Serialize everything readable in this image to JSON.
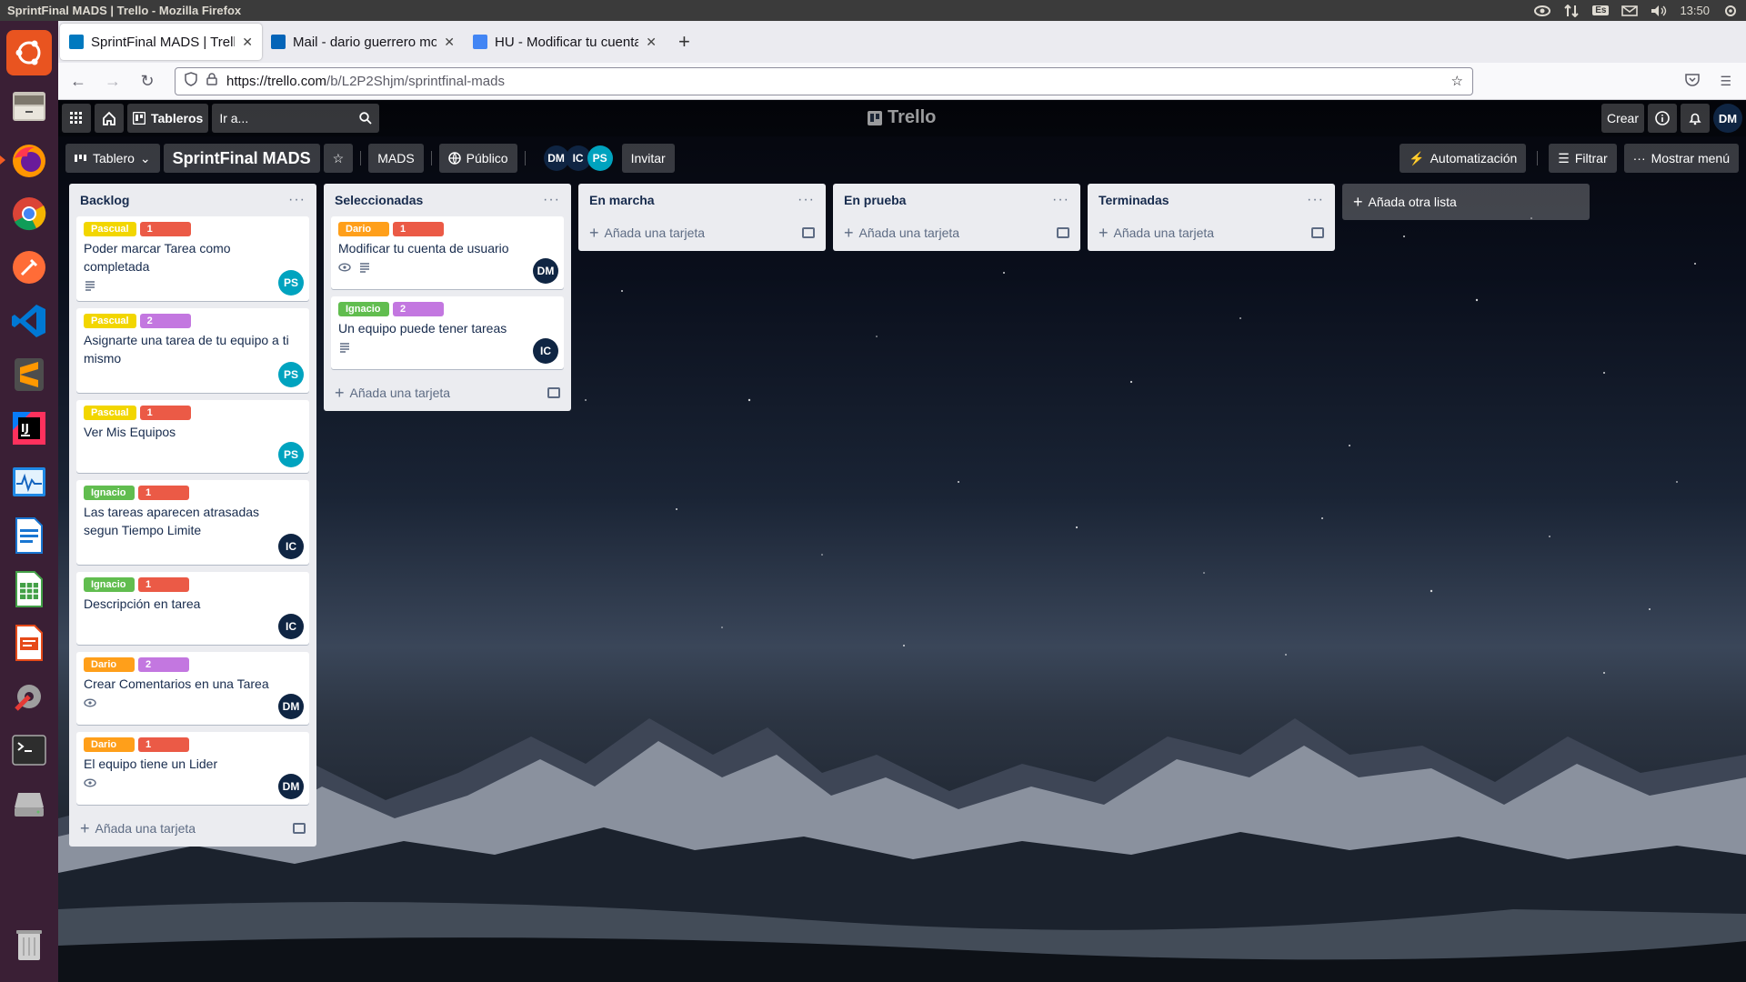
{
  "os": {
    "window_title": "SprintFinal MADS | Trello - Mozilla Firefox",
    "lang": "Es",
    "clock": "13:50"
  },
  "browser": {
    "tabs": [
      {
        "label": "SprintFinal MADS | Trello",
        "favicon_color": "#0079bf"
      },
      {
        "label": "Mail - dario guerrero mon",
        "favicon_color": "#0364b8"
      },
      {
        "label": "HU - Modificar tu cuenta",
        "favicon_color": "#4285f4"
      }
    ],
    "url_host": "https://trello.com",
    "url_path": "/b/L2P2Shjm/sprintfinal-mads"
  },
  "trello": {
    "header": {
      "boards_label": "Tableros",
      "search_placeholder": "Ir a...",
      "logo_text": "Trello",
      "create_label": "Crear",
      "user_initials": "DM"
    },
    "board": {
      "view_label": "Tablero",
      "title": "SprintFinal MADS",
      "workspace": "MADS",
      "visibility": "Público",
      "members": [
        "DM",
        "IC",
        "PS"
      ],
      "invite_label": "Invitar",
      "automation_label": "Automatización",
      "filter_label": "Filtrar",
      "menu_label": "Mostrar menú"
    },
    "add_card_label": "Añada una tarjeta",
    "add_list_label": "Añada otra lista",
    "lists": [
      {
        "title": "Backlog",
        "cards": [
          {
            "labels": [
              {
                "text": "Pascual",
                "color": "yellow"
              },
              {
                "text": "1",
                "color": "red"
              }
            ],
            "title": "Poder marcar Tarea como completada",
            "badges": [
              "description"
            ],
            "member": "PS"
          },
          {
            "labels": [
              {
                "text": "Pascual",
                "color": "yellow"
              },
              {
                "text": "2",
                "color": "purple"
              }
            ],
            "title": "Asignarte una tarea de tu equipo a ti mismo",
            "badges": [],
            "member": "PS"
          },
          {
            "labels": [
              {
                "text": "Pascual",
                "color": "yellow"
              },
              {
                "text": "1",
                "color": "red"
              }
            ],
            "title": "Ver Mis Equipos",
            "badges": [],
            "member": "PS"
          },
          {
            "labels": [
              {
                "text": "Ignacio",
                "color": "green"
              },
              {
                "text": "1",
                "color": "red"
              }
            ],
            "title": "Las tareas aparecen atrasadas segun Tiempo Limite",
            "badges": [],
            "member": "IC"
          },
          {
            "labels": [
              {
                "text": "Ignacio",
                "color": "green"
              },
              {
                "text": "1",
                "color": "red"
              }
            ],
            "title": "Descripción en tarea",
            "badges": [],
            "member": "IC"
          },
          {
            "labels": [
              {
                "text": "Dario",
                "color": "orange"
              },
              {
                "text": "2",
                "color": "purple"
              }
            ],
            "title": "Crear Comentarios en una Tarea",
            "badges": [
              "watch"
            ],
            "member": "DM"
          },
          {
            "labels": [
              {
                "text": "Dario",
                "color": "orange"
              },
              {
                "text": "1",
                "color": "red"
              }
            ],
            "title": "El equipo tiene un Lider",
            "badges": [
              "watch"
            ],
            "member": "DM"
          }
        ]
      },
      {
        "title": "Seleccionadas",
        "cards": [
          {
            "labels": [
              {
                "text": "Dario",
                "color": "orange"
              },
              {
                "text": "1",
                "color": "red"
              }
            ],
            "title": "Modificar tu cuenta de usuario",
            "badges": [
              "watch",
              "description"
            ],
            "member": "DM"
          },
          {
            "labels": [
              {
                "text": "Ignacio",
                "color": "green"
              },
              {
                "text": "2",
                "color": "purple"
              }
            ],
            "title": "Un equipo puede tener tareas",
            "badges": [
              "description"
            ],
            "member": "IC"
          }
        ]
      },
      {
        "title": "En marcha",
        "cards": []
      },
      {
        "title": "En prueba",
        "cards": []
      },
      {
        "title": "Terminadas",
        "cards": []
      }
    ]
  }
}
